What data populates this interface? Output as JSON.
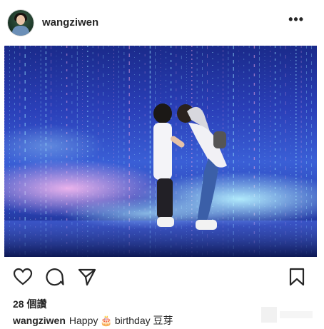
{
  "post": {
    "username": "wangziwen",
    "more_icon": "more-horizontal-icon",
    "more_glyph": "•••",
    "likes_text": "28 個讚",
    "caption": {
      "username": "wangziwen",
      "text_before": "Happy",
      "emoji": "🎂",
      "text_after": "birthday 豆芽"
    },
    "actions": [
      "heart-icon",
      "comment-icon",
      "share-icon",
      "bookmark-icon"
    ]
  },
  "colors": {
    "text": "#262626",
    "photo_blue": "#2a3fb8",
    "light_pink": "#e9a3e0",
    "light_cyan": "#9be6ff"
  }
}
